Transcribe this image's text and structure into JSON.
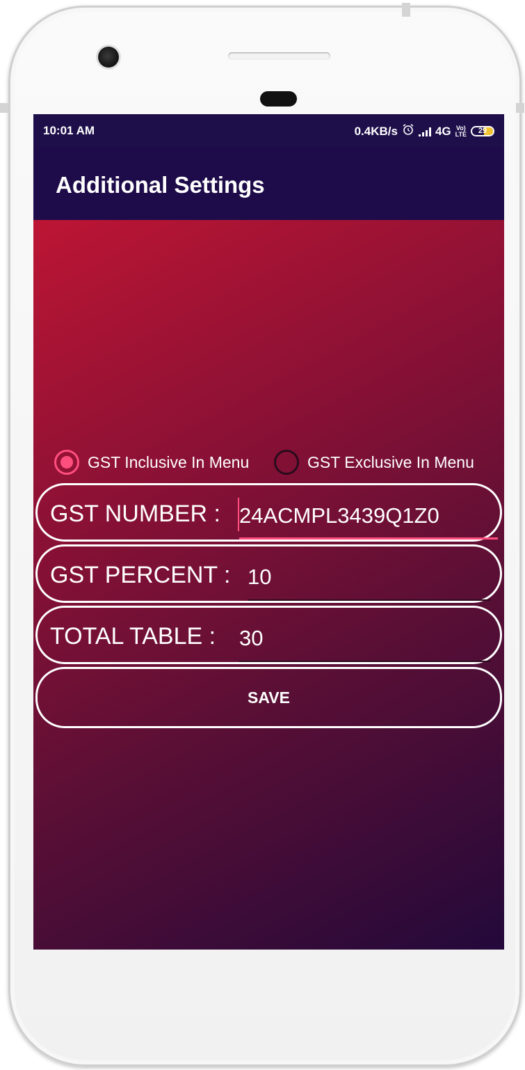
{
  "status_bar": {
    "time": "10:01 AM",
    "network_speed": "0.4KB/s",
    "network_type": "4G",
    "volte_top": "Vo)",
    "volte_bottom": "LTE",
    "battery_level": "29",
    "icons": [
      "alarm-icon",
      "signal-icon",
      "volte-icon",
      "battery-icon"
    ]
  },
  "app_bar": {
    "title": "Additional Settings",
    "color": "#1e0c4a"
  },
  "gst_mode": {
    "options": [
      {
        "label": "GST Inclusive In Menu",
        "selected": true
      },
      {
        "label": "GST Exclusive In Menu",
        "selected": false
      }
    ],
    "accent_color": "#ff4f7e"
  },
  "form": {
    "gst_number": {
      "label": "GST NUMBER :",
      "value": "24ACMPL3439Q1Z0"
    },
    "gst_percent": {
      "label": "GST PERCENT :",
      "value": "10"
    },
    "total_table": {
      "label": "TOTAL TABLE :",
      "value": "30"
    },
    "save_label": "SAVE"
  },
  "theme": {
    "gradient_start": "#bd1534",
    "gradient_end": "#23093a"
  }
}
